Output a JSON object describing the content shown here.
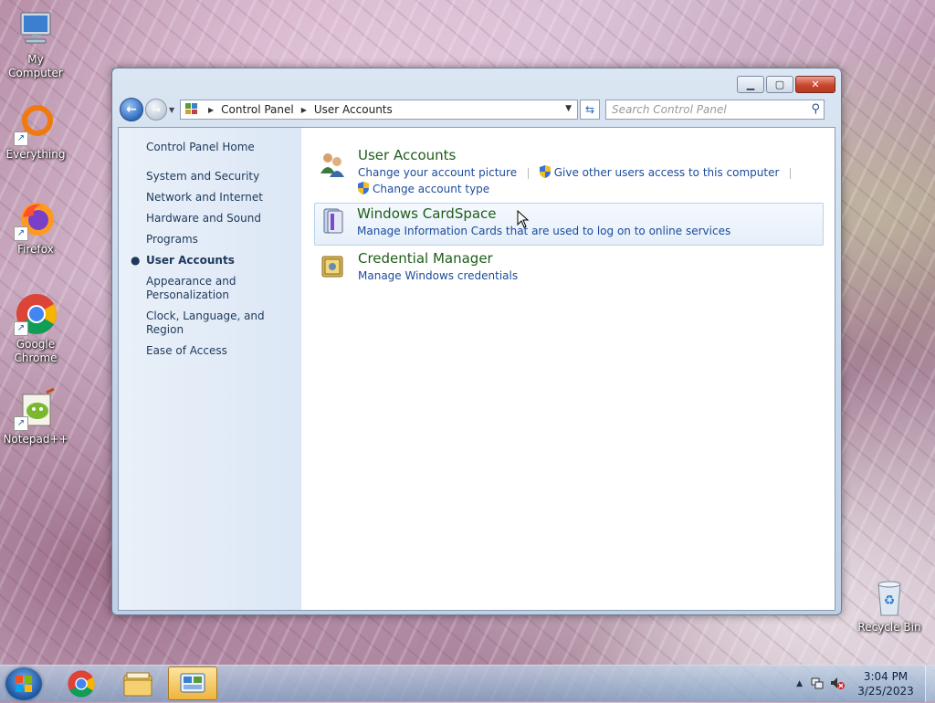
{
  "desktop": {
    "icons": [
      {
        "label": "My Computer",
        "icon": "computer-icon"
      },
      {
        "label": "Everything",
        "icon": "everything-icon"
      },
      {
        "label": "Firefox",
        "icon": "firefox-icon"
      },
      {
        "label": "Google Chrome",
        "icon": "chrome-icon"
      },
      {
        "label": "Notepad++",
        "icon": "notepadpp-icon"
      },
      {
        "label": "Recycle Bin",
        "icon": "recycle-bin-icon"
      }
    ]
  },
  "window": {
    "address": {
      "crumbs": [
        "Control Panel",
        "User Accounts"
      ]
    },
    "search": {
      "placeholder": "Search Control Panel"
    },
    "leftpane": {
      "home": "Control Panel Home",
      "categories": [
        "System and Security",
        "Network and Internet",
        "Hardware and Sound",
        "Programs",
        "User Accounts",
        "Appearance and Personalization",
        "Clock, Language, and Region",
        "Ease of Access"
      ],
      "active_index": 4
    },
    "main": {
      "items": [
        {
          "title": "User Accounts",
          "links": [
            "Change your account picture",
            "Give other users access to this computer",
            "Change account type"
          ]
        },
        {
          "title": "Windows CardSpace",
          "links": [
            "Manage Information Cards that are used to log on to online services"
          ]
        },
        {
          "title": "Credential Manager",
          "links": [
            "Manage Windows credentials"
          ]
        }
      ]
    }
  },
  "taskbar": {
    "clock": {
      "time": "3:04 PM",
      "date": "3/25/2023"
    }
  }
}
